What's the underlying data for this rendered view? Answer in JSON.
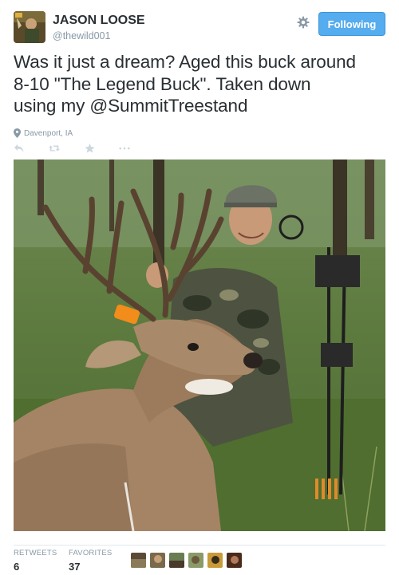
{
  "user": {
    "name": "JASON LOOSE",
    "handle": "@thewild001",
    "avatar_icon": "profile-photo-icon"
  },
  "follow_button": {
    "label": "Following",
    "color": "#55acee"
  },
  "tweet": {
    "line1": "Was it just a dream?  Aged this buck around",
    "line2": "8-10 \"The Legend Buck\".   Taken down",
    "line3": "using my @SummitTreestand"
  },
  "location": {
    "text": "Davenport, IA",
    "icon": "location-pin-icon"
  },
  "actions": [
    {
      "name": "reply",
      "icon": "reply-icon"
    },
    {
      "name": "retweet",
      "icon": "retweet-icon"
    },
    {
      "name": "favorite",
      "icon": "star-icon"
    },
    {
      "name": "more",
      "icon": "more-icon"
    }
  ],
  "photo": {
    "subject": "hunter-with-buck-photo"
  },
  "stats": {
    "retweets_label": "RETWEETS",
    "retweets_value": "6",
    "favorites_label": "FAVORITES",
    "favorites_value": "37"
  },
  "favoriters": [
    {
      "name": "favoriter-1"
    },
    {
      "name": "favoriter-2"
    },
    {
      "name": "favoriter-3"
    },
    {
      "name": "favoriter-4"
    },
    {
      "name": "favoriter-5"
    },
    {
      "name": "favoriter-6"
    }
  ]
}
